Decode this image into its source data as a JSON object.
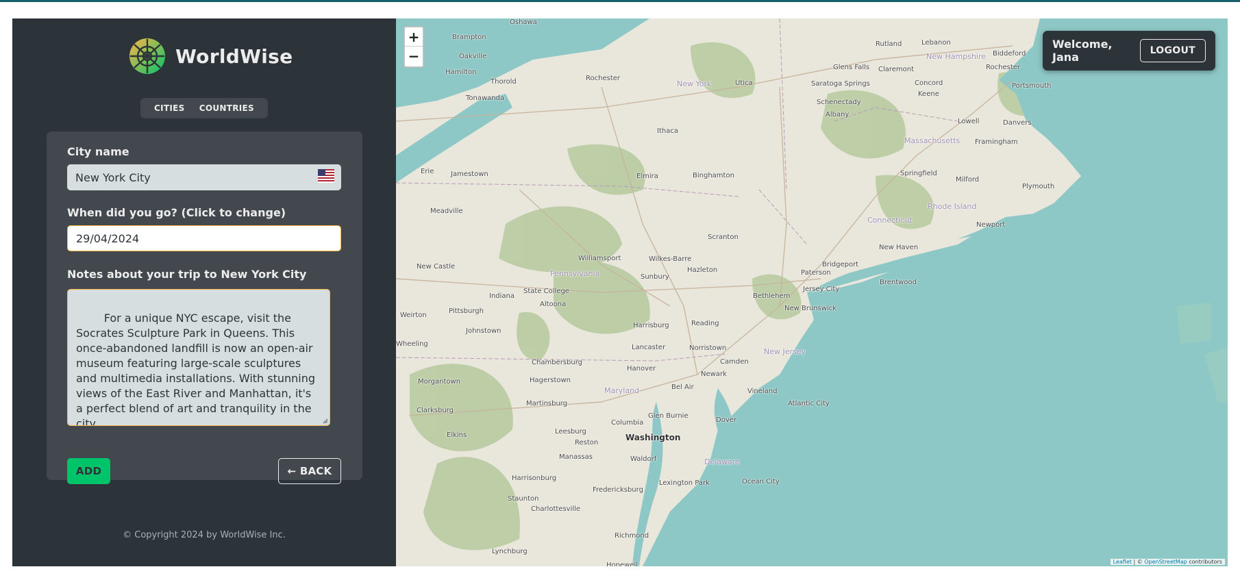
{
  "app": {
    "name": "WorldWise",
    "nav": [
      "CITIES",
      "COUNTRIES"
    ]
  },
  "form": {
    "city_label": "City name",
    "city_value": "New York City",
    "date_label": "When did you go? (Click to change)",
    "date_value": "29/04/2024",
    "notes_label": "Notes about your trip to New York City",
    "notes_value": "For a unique NYC escape, visit the Socrates Sculpture Park in Queens. This once-abandoned landfill is now an open-air museum featuring large-scale sculptures and multimedia installations. With stunning views of the East River and Manhattan, it's a perfect blend of art and tranquility in the city.",
    "add_label": "ADD",
    "back_label": "← BACK"
  },
  "footer": {
    "copyright": "© Copyright 2024 by WorldWise Inc."
  },
  "map": {
    "zoom_in": "+",
    "zoom_out": "−",
    "attribution_leaflet": "Leaflet",
    "attribution_sep": " | © ",
    "attribution_osm": "OpenStreetMap",
    "attribution_tail": " contributors",
    "places": [
      "Oshawa",
      "Brampton",
      "Oakville",
      "Hamilton",
      "Thorold",
      "Tonawanda",
      "Rochester",
      "New York",
      "Utica",
      "Rutland",
      "Lebanon",
      "New Hampshire",
      "Biddeford",
      "Glens Falls",
      "Claremont",
      "Rochester",
      "Saratoga Springs",
      "Concord",
      "Portsmouth",
      "Keene",
      "Schenectady",
      "Albany",
      "Lowell",
      "Danvers",
      "Ithaca",
      "Massachusetts",
      "Framingham",
      "Erie",
      "Jamestown",
      "Elmira",
      "Binghamton",
      "Springfield",
      "Milford",
      "Plymouth",
      "Meadville",
      "Connecticut",
      "Rhode Island",
      "Newport",
      "Scranton",
      "Williamsport",
      "Wilkes-Barre",
      "New Haven",
      "Bridgeport",
      "New Castle",
      "Pennsylvania",
      "Hazleton",
      "Paterson",
      "Brentwood",
      "Sunbury",
      "Indiana",
      "State College",
      "Altoona",
      "Bethlehem",
      "Jersey City",
      "New Brunswick",
      "Weirton",
      "Pittsburgh",
      "Johnstown",
      "Harrisburg",
      "Reading",
      "Wheeling",
      "Lancaster",
      "Norristown",
      "New Jersey",
      "Chambersburg",
      "Hanover",
      "Camden",
      "Morgantown",
      "Hagerstown",
      "Newark",
      "Maryland",
      "Bel Air",
      "Vineland",
      "Atlantic City",
      "Clarksburg",
      "Martinsburg",
      "Columbia",
      "Glen Burnie",
      "Dover",
      "Elkins",
      "Leesburg",
      "Washington",
      "Reston",
      "Manassas",
      "Waldorf",
      "Delaware",
      "Harrisonburg",
      "Lexington Park",
      "Ocean City",
      "Fredericksburg",
      "Staunton",
      "Charlottesville",
      "Richmond",
      "Lynchburg",
      "Hopewell"
    ]
  },
  "user": {
    "welcome": "Welcome, Jana",
    "logout": "LOGOUT"
  },
  "colors": {
    "sidebar_bg": "#2d3439",
    "panel_bg": "#42484d",
    "brand_green": "#00c46a",
    "accent_orange": "#ffb545",
    "water": "#8ec8c6"
  }
}
